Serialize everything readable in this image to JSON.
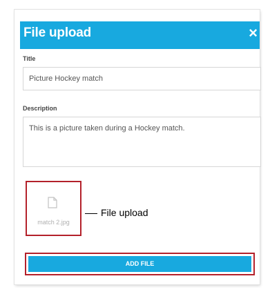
{
  "dialog": {
    "title": "File upload",
    "close_icon": "×",
    "fields": {
      "title_label": "Title",
      "title_value": "Picture Hockey match",
      "description_label": "Description",
      "description_value": "This is a picture taken during a Hockey match."
    },
    "upload": {
      "file_name": "match 2.jpg",
      "file_icon": "file-icon",
      "callout": "File upload"
    },
    "add_file_label": "ADD FILE"
  },
  "colors": {
    "header": "#18a9df",
    "button": "#18a9df",
    "highlight": "#b3202a"
  }
}
